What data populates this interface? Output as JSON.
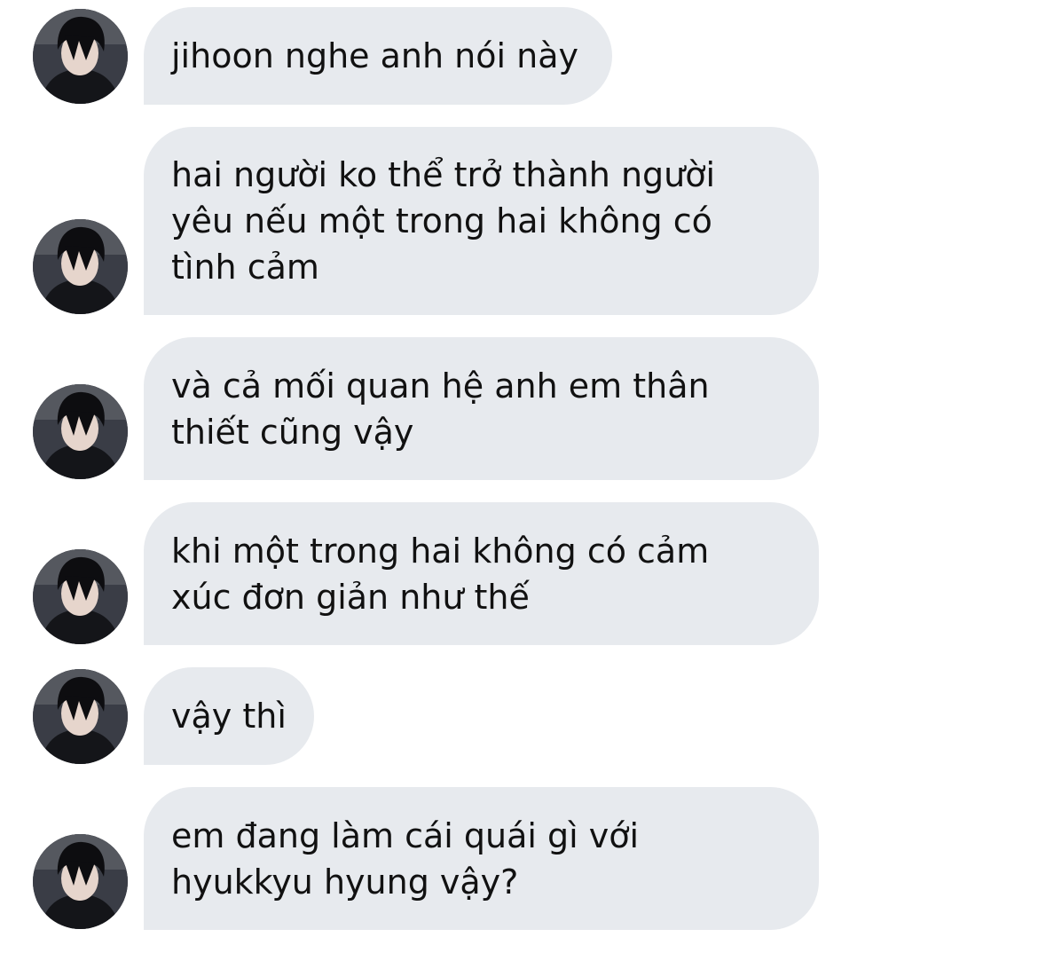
{
  "contact": {
    "avatar_icon": "person-photo-avatar"
  },
  "messages": [
    {
      "text": "jihoon nghe anh nói này"
    },
    {
      "text": "hai người ko thể trở thành người\nyêu nếu một trong hai không có\ntình cảm"
    },
    {
      "text": "và cả mối quan hệ anh em thân\nthiết cũng vậy"
    },
    {
      "text": "khi một trong hai không có cảm\nxúc đơn giản như thế"
    },
    {
      "text": "vậy thì"
    },
    {
      "text": "em đang làm cái quái gì với\nhyukkyu hyung vậy?"
    }
  ],
  "colors": {
    "bubble": "#e7eaee",
    "text": "#111111",
    "background": "#ffffff"
  }
}
